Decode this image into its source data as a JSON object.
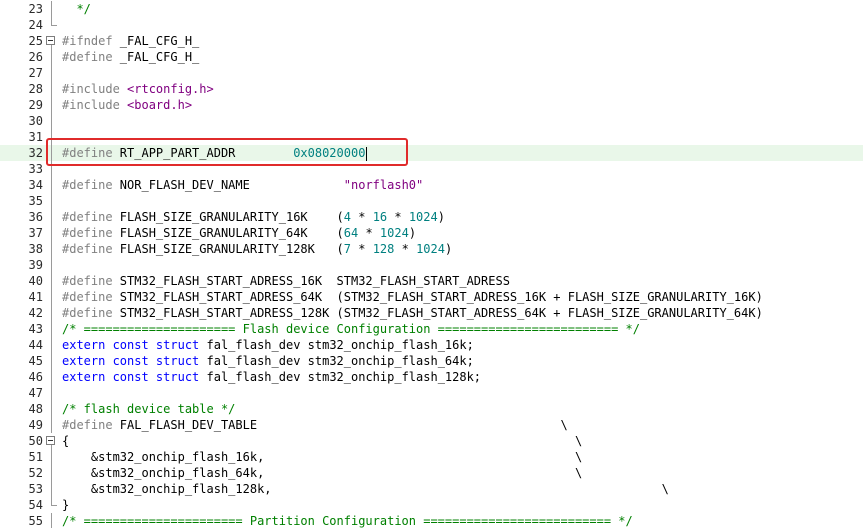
{
  "editor": {
    "current_line": "32",
    "highlight_color": "#e02b2b",
    "lines": [
      {
        "n": "23",
        "fold": "line",
        "parts": [
          {
            "t": "  */",
            "c": "cm"
          }
        ]
      },
      {
        "n": "24",
        "fold": "end",
        "parts": []
      },
      {
        "n": "25",
        "fold": "box",
        "parts": [
          {
            "t": "#ifndef ",
            "c": "pp"
          },
          {
            "t": "_FAL_CFG_H_",
            "c": ""
          }
        ]
      },
      {
        "n": "26",
        "fold": "line",
        "parts": [
          {
            "t": "#define ",
            "c": "pp"
          },
          {
            "t": "_FAL_CFG_H_",
            "c": ""
          }
        ]
      },
      {
        "n": "27",
        "fold": "line",
        "parts": []
      },
      {
        "n": "28",
        "fold": "line",
        "parts": [
          {
            "t": "#include ",
            "c": "pp"
          },
          {
            "t": "<rtconfig.h>",
            "c": "hdr"
          }
        ]
      },
      {
        "n": "29",
        "fold": "line",
        "parts": [
          {
            "t": "#include ",
            "c": "pp"
          },
          {
            "t": "<board.h>",
            "c": "hdr"
          }
        ]
      },
      {
        "n": "30",
        "fold": "line",
        "parts": []
      },
      {
        "n": "31",
        "fold": "line",
        "parts": []
      },
      {
        "n": "32",
        "fold": "line",
        "parts": [
          {
            "t": "#define ",
            "c": "pp"
          },
          {
            "t": "RT_APP_PART_ADDR        ",
            "c": ""
          },
          {
            "t": "0x08020000",
            "c": "num"
          }
        ]
      },
      {
        "n": "33",
        "fold": "line",
        "parts": []
      },
      {
        "n": "34",
        "fold": "line",
        "parts": [
          {
            "t": "#define ",
            "c": "pp"
          },
          {
            "t": "NOR_FLASH_DEV_NAME             ",
            "c": ""
          },
          {
            "t": "\"norflash0\"",
            "c": "str"
          }
        ]
      },
      {
        "n": "35",
        "fold": "line",
        "parts": []
      },
      {
        "n": "36",
        "fold": "line",
        "parts": [
          {
            "t": "#define ",
            "c": "pp"
          },
          {
            "t": "FLASH_SIZE_GRANULARITY_16K    (",
            "c": ""
          },
          {
            "t": "4",
            "c": "num"
          },
          {
            "t": " * ",
            "c": ""
          },
          {
            "t": "16",
            "c": "num"
          },
          {
            "t": " * ",
            "c": ""
          },
          {
            "t": "1024",
            "c": "num"
          },
          {
            "t": ")",
            "c": ""
          }
        ]
      },
      {
        "n": "37",
        "fold": "line",
        "parts": [
          {
            "t": "#define ",
            "c": "pp"
          },
          {
            "t": "FLASH_SIZE_GRANULARITY_64K    (",
            "c": ""
          },
          {
            "t": "64",
            "c": "num"
          },
          {
            "t": " * ",
            "c": ""
          },
          {
            "t": "1024",
            "c": "num"
          },
          {
            "t": ")",
            "c": ""
          }
        ]
      },
      {
        "n": "38",
        "fold": "line",
        "parts": [
          {
            "t": "#define ",
            "c": "pp"
          },
          {
            "t": "FLASH_SIZE_GRANULARITY_128K   (",
            "c": ""
          },
          {
            "t": "7",
            "c": "num"
          },
          {
            "t": " * ",
            "c": ""
          },
          {
            "t": "128",
            "c": "num"
          },
          {
            "t": " * ",
            "c": ""
          },
          {
            "t": "1024",
            "c": "num"
          },
          {
            "t": ")",
            "c": ""
          }
        ]
      },
      {
        "n": "39",
        "fold": "line",
        "parts": []
      },
      {
        "n": "40",
        "fold": "line",
        "parts": [
          {
            "t": "#define ",
            "c": "pp"
          },
          {
            "t": "STM32_FLASH_START_ADRESS_16K  STM32_FLASH_START_ADRESS",
            "c": ""
          }
        ]
      },
      {
        "n": "41",
        "fold": "line",
        "parts": [
          {
            "t": "#define ",
            "c": "pp"
          },
          {
            "t": "STM32_FLASH_START_ADRESS_64K  (STM32_FLASH_START_ADRESS_16K + FLASH_SIZE_GRANULARITY_16K)",
            "c": ""
          }
        ]
      },
      {
        "n": "42",
        "fold": "line",
        "parts": [
          {
            "t": "#define ",
            "c": "pp"
          },
          {
            "t": "STM32_FLASH_START_ADRESS_128K (STM32_FLASH_START_ADRESS_64K + FLASH_SIZE_GRANULARITY_64K)",
            "c": ""
          }
        ]
      },
      {
        "n": "43",
        "fold": "line",
        "parts": [
          {
            "t": "/* ===================== Flash device Configuration ========================= */",
            "c": "cm"
          }
        ]
      },
      {
        "n": "44",
        "fold": "line",
        "parts": [
          {
            "t": "extern const struct ",
            "c": "kw"
          },
          {
            "t": "fal_flash_dev stm32_onchip_flash_16k;",
            "c": ""
          }
        ]
      },
      {
        "n": "45",
        "fold": "line",
        "parts": [
          {
            "t": "extern const struct ",
            "c": "kw"
          },
          {
            "t": "fal_flash_dev stm32_onchip_flash_64k;",
            "c": ""
          }
        ]
      },
      {
        "n": "46",
        "fold": "line",
        "parts": [
          {
            "t": "extern const struct ",
            "c": "kw"
          },
          {
            "t": "fal_flash_dev stm32_onchip_flash_128k;",
            "c": ""
          }
        ]
      },
      {
        "n": "47",
        "fold": "line",
        "parts": []
      },
      {
        "n": "48",
        "fold": "line",
        "parts": [
          {
            "t": "/* flash device table */",
            "c": "cm"
          }
        ]
      },
      {
        "n": "49",
        "fold": "line",
        "parts": [
          {
            "t": "#define ",
            "c": "pp"
          },
          {
            "t": "FAL_FLASH_DEV_TABLE                                          \\",
            "c": ""
          }
        ]
      },
      {
        "n": "50",
        "fold": "box",
        "parts": [
          {
            "t": "{                                                                      \\",
            "c": ""
          }
        ]
      },
      {
        "n": "51",
        "fold": "line",
        "parts": [
          {
            "t": "    &stm32_onchip_flash_16k,                                           \\",
            "c": ""
          }
        ]
      },
      {
        "n": "52",
        "fold": "line",
        "parts": [
          {
            "t": "    &stm32_onchip_flash_64k,                                           \\",
            "c": ""
          }
        ]
      },
      {
        "n": "53",
        "fold": "line",
        "parts": [
          {
            "t": "    &stm32_onchip_flash_128k,                                                      \\",
            "c": ""
          }
        ]
      },
      {
        "n": "54",
        "fold": "end",
        "parts": [
          {
            "t": "}",
            "c": ""
          }
        ]
      },
      {
        "n": "55",
        "fold": "line",
        "parts": [
          {
            "t": "/* ====================== Partition Configuration ========================== */",
            "c": "cm"
          }
        ]
      }
    ]
  }
}
